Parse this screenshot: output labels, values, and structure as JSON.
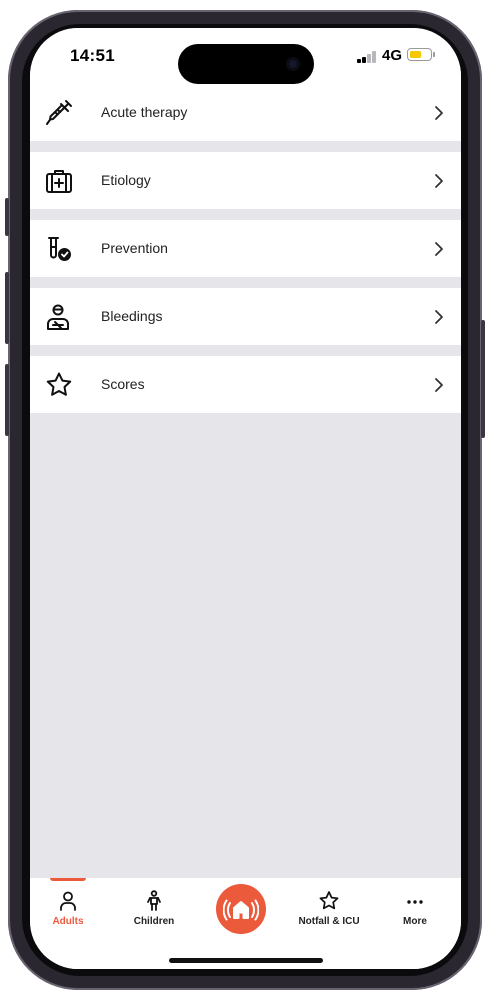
{
  "status_bar": {
    "time": "14:51",
    "network": "4G",
    "battery_color": "#f5c800"
  },
  "menu": {
    "items": [
      {
        "label": "Acute therapy",
        "icon": "syringe-icon"
      },
      {
        "label": "Etiology",
        "icon": "medical-kit-icon"
      },
      {
        "label": "Prevention",
        "icon": "test-tube-check-icon"
      },
      {
        "label": "Bleedings",
        "icon": "injured-person-icon"
      },
      {
        "label": "Scores",
        "icon": "star-icon"
      }
    ]
  },
  "tabbar": {
    "accent_color": "#ec5a3c",
    "tabs": [
      {
        "label": "Adults",
        "icon": "adult-person-icon",
        "active": true
      },
      {
        "label": "Children",
        "icon": "child-icon",
        "active": false
      },
      {
        "label": "Notfall & ICU",
        "icon": "star-outline-icon",
        "active": false
      },
      {
        "label": "More",
        "icon": "more-dots-icon",
        "active": false
      }
    ],
    "home_icon": "emergency-home-icon"
  }
}
